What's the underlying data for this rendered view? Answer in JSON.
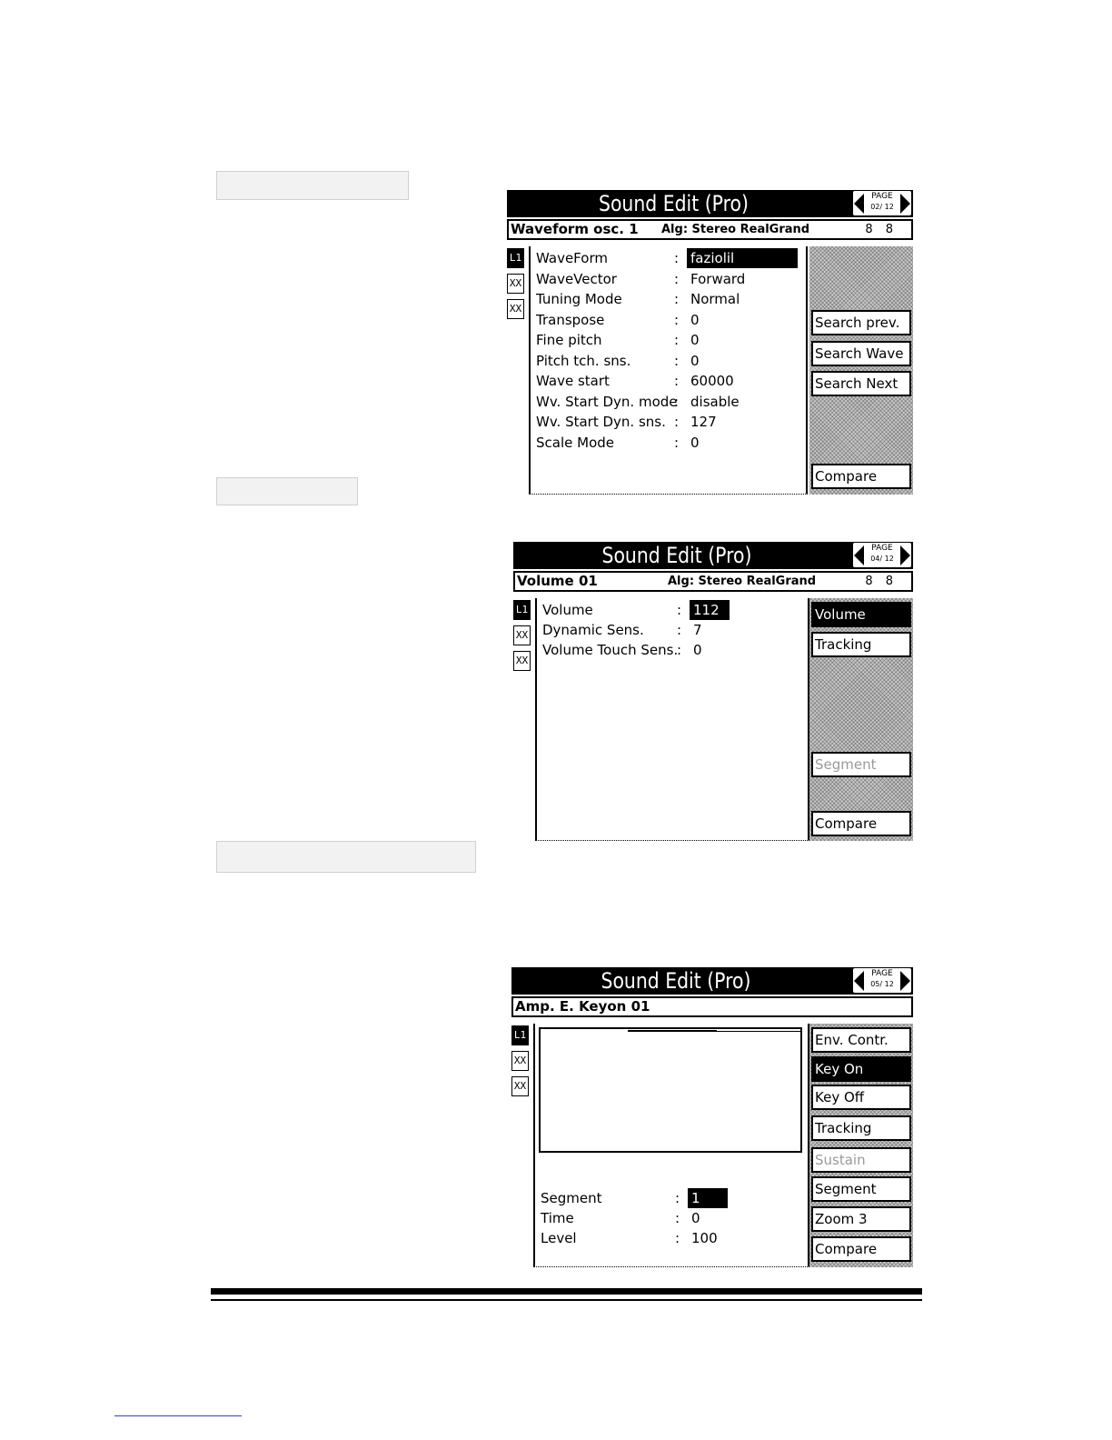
{
  "screens": [
    {
      "title": "Sound Edit (Pro)",
      "page_label": "PAGE",
      "page_num": "02/ 12",
      "info_name": "Waveform osc. 1",
      "info_alg": "Alg: Stereo   RealGrand",
      "info_nums": "8 8",
      "layers": [
        "L1",
        "XX",
        "XX"
      ],
      "params": [
        {
          "label": "WaveForm",
          "value": "faziolil"
        },
        {
          "label": "WaveVector",
          "value": "Forward"
        },
        {
          "label": "Tuning Mode",
          "value": "Normal"
        },
        {
          "label": "Transpose",
          "value": "0"
        },
        {
          "label": "Fine pitch",
          "value": "0"
        },
        {
          "label": "Pitch tch. sns.",
          "value": "0"
        },
        {
          "label": "Wave start",
          "value": "60000"
        },
        {
          "label": "Wv. Start Dyn. mode",
          "value": "disable"
        },
        {
          "label": "Wv. Start Dyn. sns.",
          "value": "127"
        },
        {
          "label": "Scale Mode",
          "value": "0"
        }
      ],
      "side_buttons": [
        "Search prev.",
        "Search Wave",
        "Search Next",
        "Compare"
      ]
    },
    {
      "title": "Sound Edit (Pro)",
      "page_label": "PAGE",
      "page_num": "04/ 12",
      "info_name": "Volume 01",
      "info_alg": "Alg: Stereo   RealGrand",
      "info_nums": "8 8",
      "layers": [
        "L1",
        "XX",
        "XX"
      ],
      "params": [
        {
          "label": "Volume",
          "value": "112"
        },
        {
          "label": "Dynamic Sens.",
          "value": "7"
        },
        {
          "label": "Volume Touch Sens.",
          "value": "0"
        }
      ],
      "side_buttons": [
        "Volume",
        "Tracking",
        "Segment",
        "Compare"
      ]
    },
    {
      "title": "Sound Edit (Pro)",
      "page_label": "PAGE",
      "page_num": "05/ 12",
      "info_name": "Amp. E. Keyon 01",
      "layers": [
        "L1",
        "XX",
        "XX"
      ],
      "params": [
        {
          "label": "Segment",
          "value": "1"
        },
        {
          "label": "Time",
          "value": "0"
        },
        {
          "label": "Level",
          "value": "100"
        }
      ],
      "side_buttons": [
        "Env. Contr.",
        "Key On",
        "Key Off",
        "Tracking",
        "Sustain",
        "Segment",
        "Zoom 3",
        "Compare"
      ]
    }
  ],
  "colors": {
    "screen_bg": "#ffffff",
    "screen_fg": "#000000",
    "placeholder": "#f2f2f2"
  }
}
